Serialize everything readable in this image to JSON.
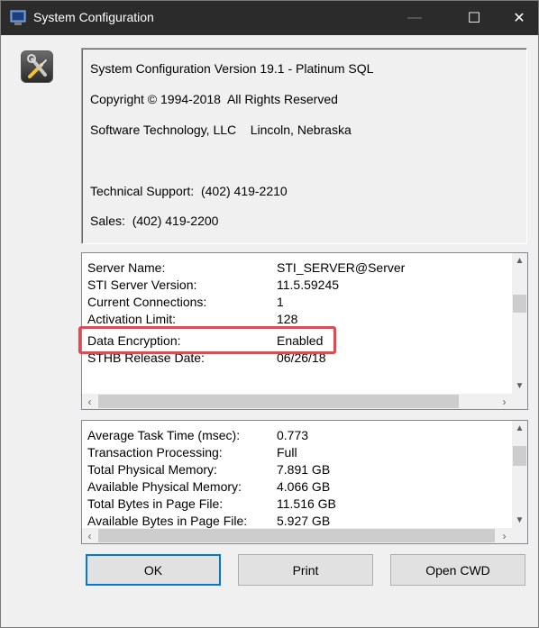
{
  "window": {
    "title": "System Configuration",
    "controls": {
      "minimize": "—",
      "maximize": "☐",
      "close": "✕"
    }
  },
  "info": {
    "version": "System Configuration Version 19.1 - Platinum SQL",
    "copyright": "Copyright © 1994-2018  All Rights Reserved",
    "company": "Software Technology, LLC    Lincoln, Nebraska",
    "support": "Technical Support:  (402) 419-2210",
    "sales": "Sales:  (402) 419-2200"
  },
  "server_info": {
    "rows": [
      {
        "label": "Server Name:",
        "value": "STI_SERVER@Server"
      },
      {
        "label": "STI Server Version:",
        "value": "11.5.59245"
      },
      {
        "label": "Current Connections:",
        "value": "1"
      },
      {
        "label": "Activation Limit:",
        "value": "128"
      },
      {
        "label": "Data Encryption:",
        "value": "Enabled"
      },
      {
        "label": "STHB Release Date:",
        "value": "06/26/18"
      }
    ],
    "highlighted_row": "Data Encryption:"
  },
  "performance_info": {
    "rows": [
      {
        "label": "Average Task Time (msec):",
        "value": "0.773"
      },
      {
        "label": "Transaction Processing:",
        "value": "Full"
      },
      {
        "label": "Total Physical Memory:",
        "value": "7.891 GB"
      },
      {
        "label": "Available Physical Memory:",
        "value": "4.066 GB"
      },
      {
        "label": "Total Bytes in Page File:",
        "value": "11.516 GB"
      },
      {
        "label": "Available Bytes in Page File:",
        "value": "5.927 GB"
      }
    ]
  },
  "buttons": {
    "ok": "OK",
    "print": "Print",
    "open_cwd": "Open CWD"
  },
  "colors": {
    "titlebar": "#2b2b2b",
    "highlight_border": "#e8474f",
    "default_button_border": "#0078d7"
  },
  "icons": {
    "app": "window-app-icon",
    "about": "tools-wrench-screwdriver-icon"
  }
}
